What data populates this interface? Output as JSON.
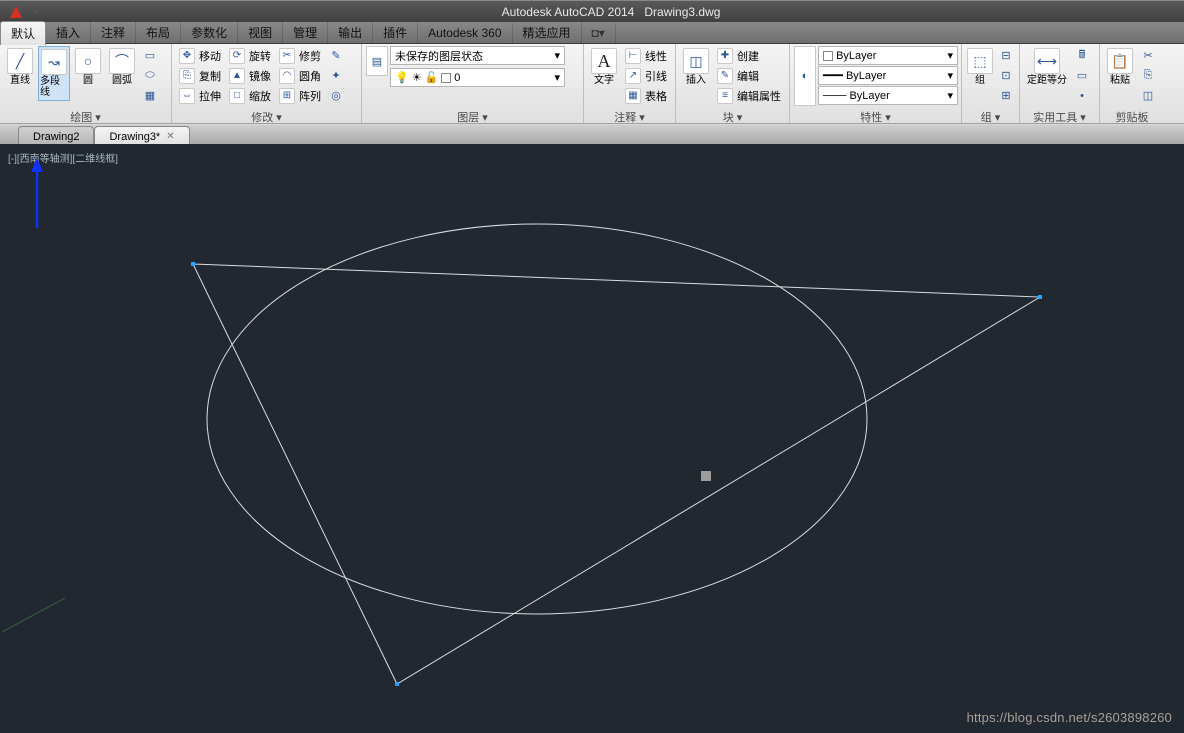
{
  "title": {
    "app": "Autodesk AutoCAD 2014",
    "doc": "Drawing3.dwg"
  },
  "menu": {
    "tabs": [
      "默认",
      "插入",
      "注释",
      "布局",
      "参数化",
      "视图",
      "管理",
      "输出",
      "插件",
      "Autodesk 360",
      "精选应用"
    ]
  },
  "ribbon": {
    "draw": {
      "title": "绘图 ▾",
      "line": "直线",
      "polyline": "多段线",
      "circle": "圆",
      "arc": "圆弧"
    },
    "modify": {
      "title": "修改 ▾",
      "move": "移动",
      "rotate": "旋转",
      "trim": "修剪",
      "copy": "复制",
      "mirror": "镜像",
      "fillet": "圆角",
      "stretch": "拉伸",
      "scale": "缩放",
      "array": "阵列"
    },
    "layers": {
      "title": "图层 ▾",
      "unsaved": "未保存的图层状态",
      "current": "0"
    },
    "annot": {
      "title": "注释 ▾",
      "text": "文字",
      "linear": "线性",
      "leader": "引线",
      "table": "表格"
    },
    "block": {
      "title": "块 ▾",
      "insert": "插入",
      "create": "创建",
      "edit": "编辑",
      "attr": "编辑属性"
    },
    "prop": {
      "title": "特性 ▾",
      "bylayer": "ByLayer"
    },
    "group": {
      "title": "组 ▾",
      "group": "组"
    },
    "util": {
      "title": "实用工具 ▾",
      "dist": "定距等分"
    },
    "clip": {
      "title": "剪贴板",
      "paste": "粘贴"
    }
  },
  "doctabs": [
    "Drawing2",
    "Drawing3*"
  ],
  "viewport_label": "[-][西南等轴测][二维线框]",
  "watermark": "https://blog.csdn.net/s2603898260"
}
